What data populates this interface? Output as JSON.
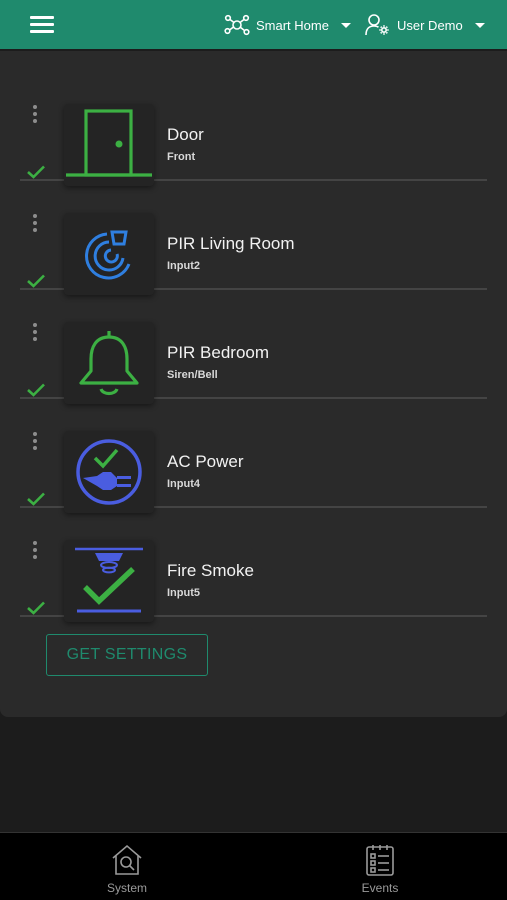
{
  "header": {
    "menu_icon": "hamburger-icon",
    "home_icon": "network-icon",
    "home_label": "Smart Home",
    "user_icon": "user-settings-icon",
    "user_label": "User Demo",
    "color": "#1f8a6d"
  },
  "devices": [
    {
      "name": "Door",
      "sub": "Front",
      "icon": "door-icon",
      "status": "ok"
    },
    {
      "name": "PIR Living Room",
      "sub": "Input2",
      "icon": "pir-sensor-icon",
      "status": "ok"
    },
    {
      "name": "PIR Bedroom",
      "sub": "Siren/Bell",
      "icon": "bell-icon",
      "status": "ok"
    },
    {
      "name": "AC Power",
      "sub": "Input4",
      "icon": "ac-power-plug-icon",
      "status": "ok"
    },
    {
      "name": "Fire Smoke",
      "sub": "Input5",
      "icon": "smoke-detector-icon",
      "status": "ok"
    }
  ],
  "actions": {
    "get_settings_label": "GET SETTINGS"
  },
  "bottom_nav": {
    "system_label": "System",
    "system_icon": "house-search-icon",
    "events_label": "Events",
    "events_icon": "event-list-icon"
  },
  "colors": {
    "accent": "#1f8a6d",
    "check": "#3cb043",
    "icon_green": "#3cb043",
    "icon_blue": "#2f7fe0",
    "icon_indigo": "#4a5de0"
  }
}
